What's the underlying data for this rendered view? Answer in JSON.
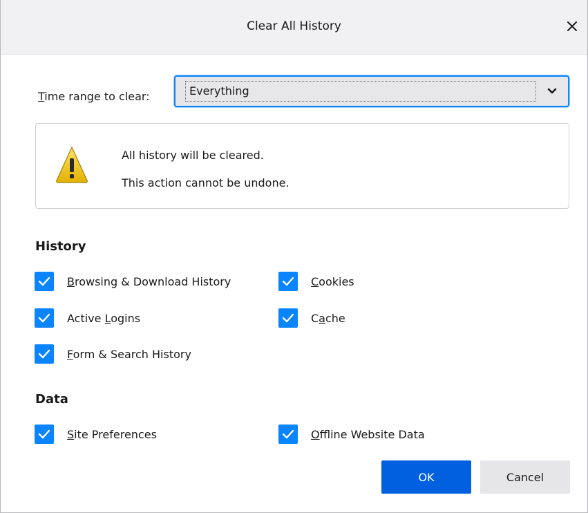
{
  "dialog": {
    "title": "Clear All History",
    "close_icon": "close-icon"
  },
  "time_range": {
    "label_prefix": "T",
    "label_rest": "ime range to clear:",
    "selected": "Everything",
    "arrow_icon": "chevron-down-icon"
  },
  "warning": {
    "icon": "warning-icon",
    "line1": "All history will be cleared.",
    "line2": "This action cannot be undone."
  },
  "history": {
    "heading": "History",
    "items": [
      {
        "pre": "",
        "u": "B",
        "post": "rowsing & Download History",
        "checked": true
      },
      {
        "pre": "",
        "u": "C",
        "post": "ookies",
        "checked": true
      },
      {
        "pre": "Active ",
        "u": "L",
        "post": "ogins",
        "checked": true
      },
      {
        "pre": "C",
        "u": "a",
        "post": "che",
        "checked": true
      },
      {
        "pre": "",
        "u": "F",
        "post": "orm & Search History",
        "checked": true
      }
    ]
  },
  "data_section": {
    "heading": "Data",
    "items": [
      {
        "pre": "",
        "u": "S",
        "post": "ite Preferences",
        "checked": true
      },
      {
        "pre": "",
        "u": "O",
        "post": "ffline Website Data",
        "checked": true
      }
    ]
  },
  "buttons": {
    "ok": "OK",
    "cancel": "Cancel"
  },
  "colors": {
    "accent": "#0a84ff",
    "primary_button": "#0060df",
    "titlebar": "#f1f1f3"
  }
}
